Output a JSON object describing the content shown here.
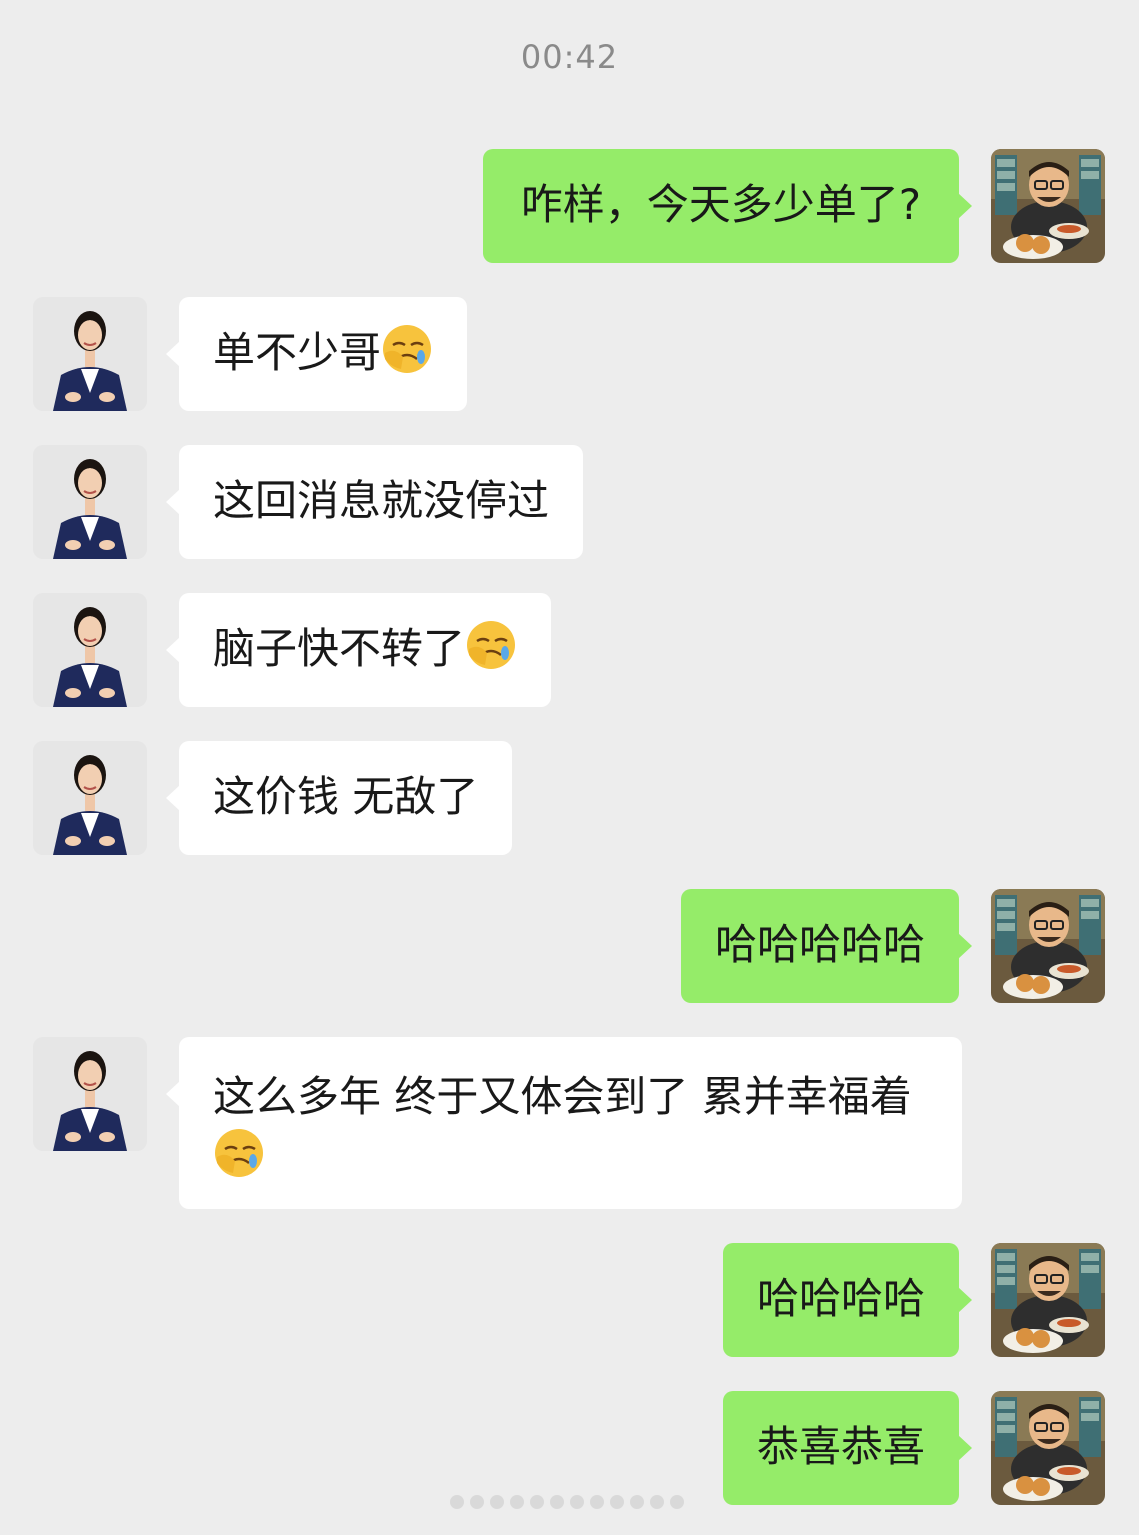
{
  "chat": {
    "timestamp": "00:42",
    "messages": [
      {
        "side": "right",
        "text": "咋样，今天多少单了?"
      },
      {
        "side": "left",
        "text": "单不少哥",
        "emoji": "facepalm-emoji"
      },
      {
        "side": "left",
        "text": "这回消息就没停过"
      },
      {
        "side": "left",
        "text": "脑子快不转了",
        "emoji": "facepalm-emoji"
      },
      {
        "side": "left",
        "text": "这价钱 无敌了"
      },
      {
        "side": "right",
        "text": "哈哈哈哈哈"
      },
      {
        "side": "left",
        "text": "这么多年 终于又体会到了 累并幸福着",
        "emoji": "facepalm-emoji"
      },
      {
        "side": "right",
        "text": "哈哈哈哈"
      },
      {
        "side": "right",
        "text": "恭喜恭喜"
      }
    ]
  },
  "colors": {
    "background": "#ededed",
    "bubble_right": "#95ec69",
    "bubble_left": "#ffffff",
    "timestamp_text": "#8a8a8a",
    "message_text": "#191919"
  },
  "icons": {
    "self_avatar": "cartoon-man-avatar",
    "contact_avatar": "woman-in-suit-avatar",
    "emoji": "facepalm-emoji"
  }
}
